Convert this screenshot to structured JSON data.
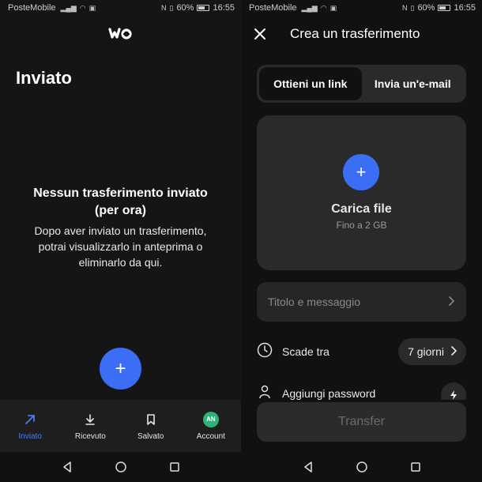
{
  "status": {
    "carrier": "PosteMobile",
    "battery": "60%",
    "time": "16:55"
  },
  "left": {
    "page_title": "Inviato",
    "empty_title_line1": "Nessun trasferimento inviato",
    "empty_title_line2": "(per ora)",
    "empty_desc_line1": "Dopo aver inviato un trasferimento,",
    "empty_desc_line2": "potrai visualizzarlo in anteprima o",
    "empty_desc_line3": "eliminarlo da qui.",
    "fab_label": "+",
    "nav": [
      {
        "label": "Inviato",
        "icon": "arrow-up-right-icon",
        "active": true
      },
      {
        "label": "Ricevuto",
        "icon": "download-icon",
        "active": false
      },
      {
        "label": "Salvato",
        "icon": "bookmark-icon",
        "active": false
      },
      {
        "label": "Account",
        "icon": "avatar",
        "active": false
      }
    ],
    "avatar_initials": "AN"
  },
  "right": {
    "title": "Crea un trasferimento",
    "tabs": [
      {
        "label": "Ottieni un link",
        "active": true
      },
      {
        "label": "Invia un'e-mail",
        "active": false
      }
    ],
    "upload_plus": "+",
    "upload_label": "Carica file",
    "upload_limit": "Fino a 2 GB",
    "title_placeholder": "Titolo e messaggio",
    "expiry_label": "Scade tra",
    "expiry_value": "7 giorni",
    "password_label": "Aggiungi password",
    "transfer_label": "Transfer"
  },
  "colors": {
    "accent": "#3c6df5",
    "active_nav": "#4a7bff",
    "avatar": "#2fb27a"
  }
}
